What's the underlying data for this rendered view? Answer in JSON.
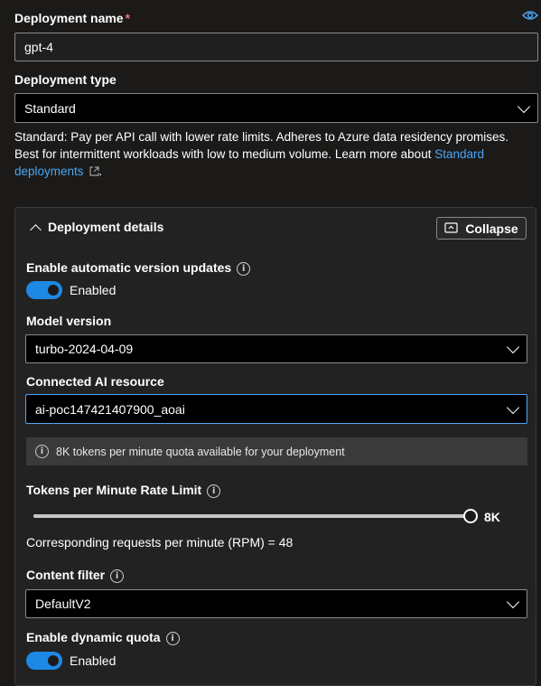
{
  "deployment_name": {
    "label": "Deployment name",
    "required_mark": "*",
    "value": "gpt-4"
  },
  "deployment_type": {
    "label": "Deployment type",
    "value": "Standard",
    "description": "Standard: Pay per API call with lower rate limits. Adheres to Azure data residency promises. Best for intermittent workloads with low to medium volume. Learn more about ",
    "link_text": "Standard deployments",
    "description_end": "."
  },
  "details": {
    "title": "Deployment details",
    "collapse_label": "Collapse",
    "auto_update": {
      "label": "Enable automatic version updates",
      "state": "Enabled",
      "on": true
    },
    "model_version": {
      "label": "Model version",
      "value": "turbo-2024-04-09"
    },
    "connected_resource": {
      "label": "Connected AI resource",
      "value": "ai-poc147421407900_aoai"
    },
    "quota_note": "8K tokens per minute quota available for your deployment",
    "tpm": {
      "label": "Tokens per Minute Rate Limit",
      "value_label": "8K",
      "fill_fraction": 1.0
    },
    "rpm_text": "Corresponding requests per minute (RPM) = 48",
    "content_filter": {
      "label": "Content filter",
      "value": "DefaultV2"
    },
    "dynamic_quota": {
      "label": "Enable dynamic quota",
      "state": "Enabled",
      "on": true
    }
  },
  "colors": {
    "accent": "#1e88e5",
    "link": "#4aa6f5",
    "background": "#1b1a19"
  }
}
